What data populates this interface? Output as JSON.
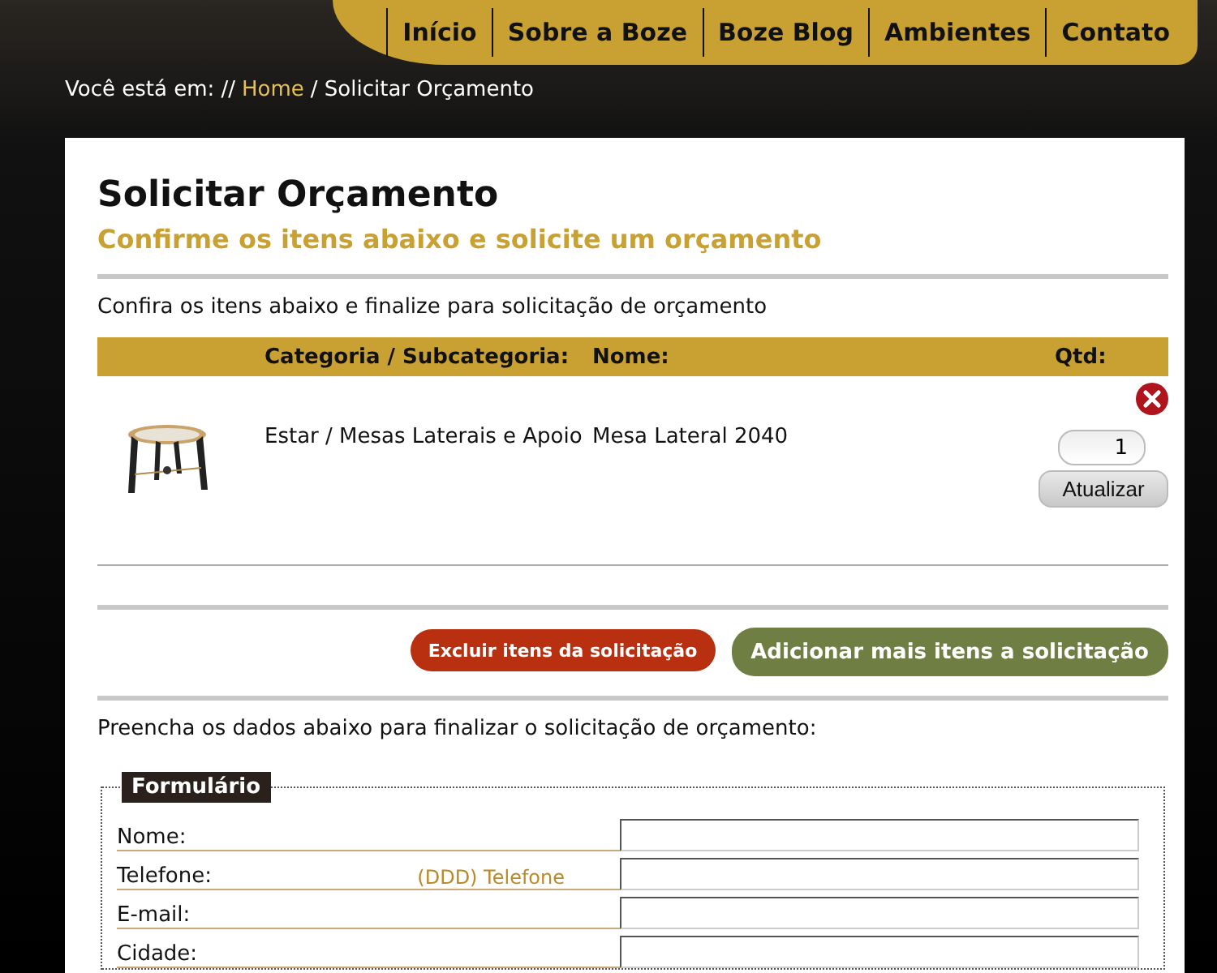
{
  "nav": [
    {
      "label": "Início"
    },
    {
      "label": "Sobre a Boze"
    },
    {
      "label": "Boze Blog"
    },
    {
      "label": "Ambientes"
    },
    {
      "label": "Contato"
    }
  ],
  "breadcrumb": {
    "prefix": "Você está em: //",
    "link": "Home",
    "current": "/ Solicitar Orçamento"
  },
  "title": "Solicitar Orçamento",
  "subtitle": "Confirme os itens abaixo e solicite um orçamento",
  "intro": "Confira os itens abaixo e finalize para solicitação de orçamento",
  "table": {
    "columns": [
      "Categoria / Subcategoria:",
      "Nome:",
      "Qtd:"
    ],
    "rows": [
      {
        "category": "Estar / Mesas Laterais e Apoio",
        "name": "Mesa Lateral 2040",
        "quantity": "1",
        "update_button": "Atualizar"
      }
    ]
  },
  "buttons": [
    {
      "label": "Excluir itens da solicitação",
      "kind": "danger"
    },
    {
      "label": "Adicionar mais itens a solicitação",
      "kind": "primary"
    }
  ],
  "form_intro": "Preencha os dados abaixo para finalizar o solicitação de orçamento:",
  "form": {
    "legend": "Formulário",
    "fields": [
      {
        "label": "Nome:"
      },
      {
        "label": "Telefone:",
        "hint": "(DDD) Telefone"
      },
      {
        "label": "E-mail:"
      },
      {
        "label": "Cidade:"
      }
    ]
  }
}
